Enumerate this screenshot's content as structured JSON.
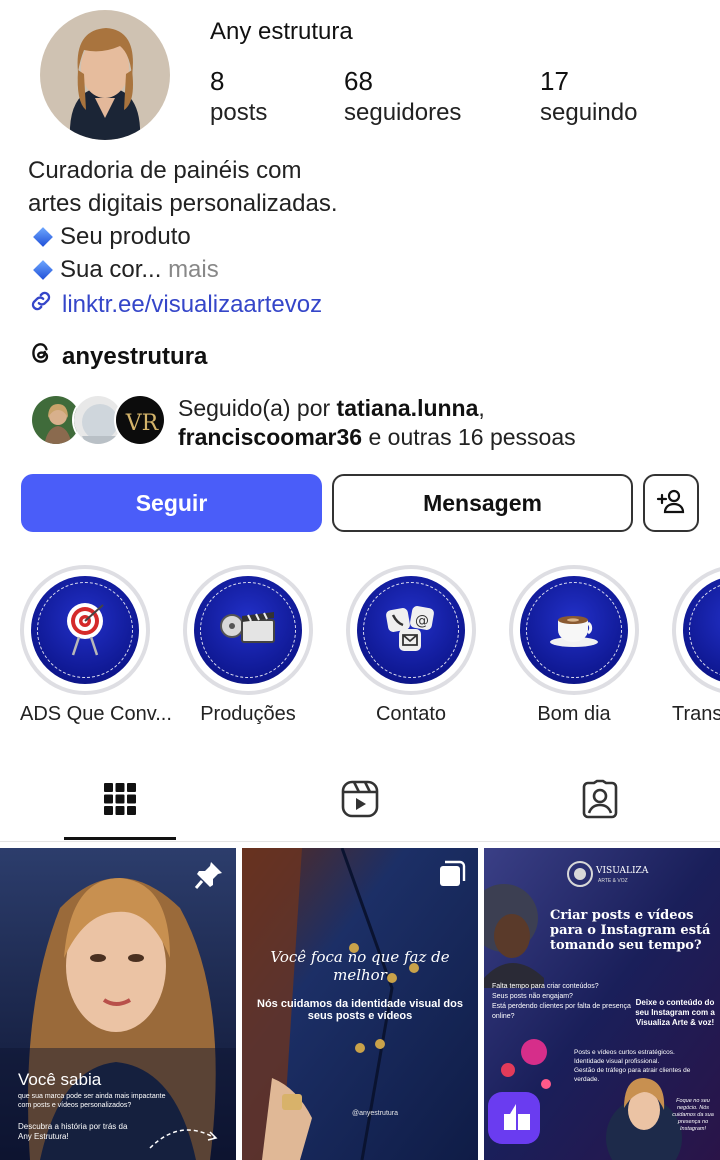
{
  "profile": {
    "name": "Any estrutura",
    "stats": [
      {
        "value": "8",
        "label": "posts"
      },
      {
        "value": "68",
        "label": "seguidores"
      },
      {
        "value": "17",
        "label": "seguindo"
      }
    ],
    "bio": {
      "line1": "Curadoria de painéis com",
      "line2": "artes digitais personalizadas.",
      "line3": "Seu produto",
      "line4": "Sua cor...",
      "more": "mais"
    },
    "link": "linktr.ee/visualizaartevoz",
    "threads_handle": "anyestrutura"
  },
  "followed_by": {
    "prefix": "Seguido(a) por",
    "user1": "tatiana.lunna",
    "comma": ",",
    "user2": "franciscoomar36",
    "suffix": "e outras 16 pessoas"
  },
  "actions": {
    "follow": "Seguir",
    "message": "Mensagem"
  },
  "highlights": [
    {
      "label": "ADS Que Conv...",
      "icon": "target-icon"
    },
    {
      "label": "Produções",
      "icon": "film-icon"
    },
    {
      "label": "Contato",
      "icon": "contact-icon"
    },
    {
      "label": "Bom dia",
      "icon": "coffee-icon"
    },
    {
      "label": "Trans",
      "icon": "transform-icon"
    }
  ],
  "tabs": [
    {
      "name": "grid",
      "icon": "grid-icon",
      "active": true
    },
    {
      "name": "reels",
      "icon": "reels-icon",
      "active": false
    },
    {
      "name": "tagged",
      "icon": "tagged-icon",
      "active": false
    }
  ],
  "posts": [
    {
      "pinned": true,
      "title": "Você sabia",
      "subtitle": "que sua marca pode ser ainda mais impactante com posts e vídeos personalizados?",
      "cta": "Descubra a história por trás da Any Estrutura!"
    },
    {
      "multiple": true,
      "script_line": "Você foca no que faz de melhor",
      "headline": "Nós cuidamos da identidade visual dos seus posts e vídeos",
      "handle": "@anyestrutura"
    },
    {
      "brand": "VISUALIZA",
      "brand_sub": "ARTE & VOZ",
      "headline": "Criar posts e vídeos para o Instagram está tomando seu tempo?",
      "bullets": [
        "Falta tempo para criar conteúdos?",
        "Seus posts não engajam?",
        "Está perdendo clientes por falta de presença online?"
      ],
      "callout": "Deixe o conteúdo do seu Instagram com a Visualiza Arte & voz!",
      "services": [
        "Posts e vídeos curtos estratégicos.",
        "Identidade visual profissional.",
        "Gestão de tráfego para atrair clientes de verdade."
      ],
      "footer": "Foque no seu negócio. Nós cuidamos da sua presença no Instagram!"
    }
  ],
  "colors": {
    "primary": "#4a5df9",
    "link": "#3546c9",
    "highlight_bg": "#0e1790"
  }
}
